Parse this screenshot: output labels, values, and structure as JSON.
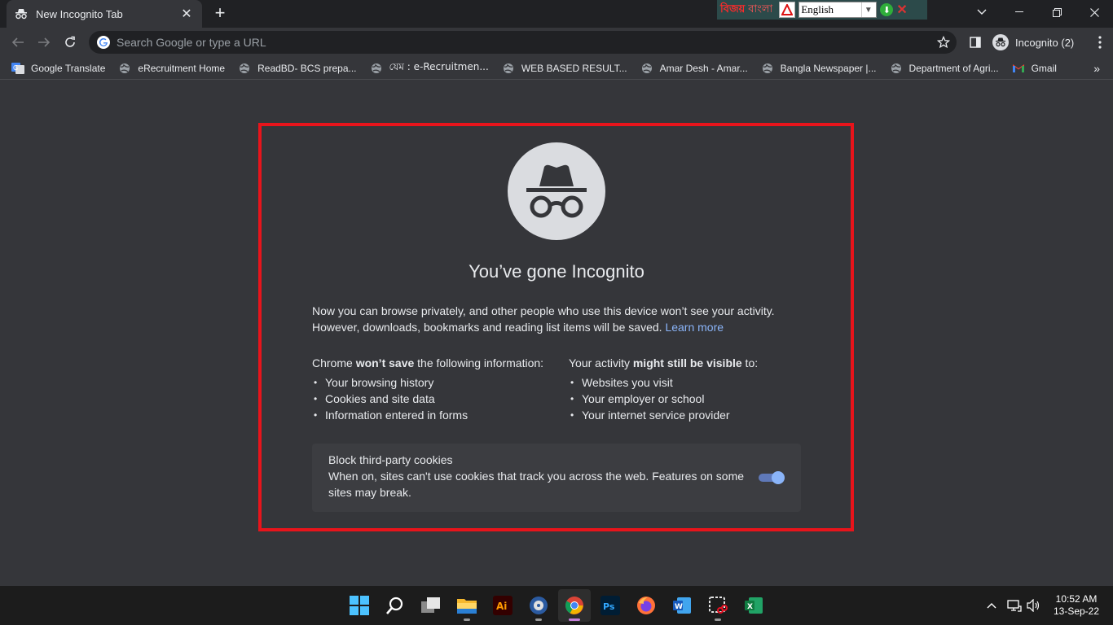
{
  "tab": {
    "title": "New Incognito Tab",
    "close": "✕"
  },
  "ime_toolbar": {
    "brand": "বিজয়",
    "script": "বাংলা",
    "language": "English"
  },
  "omnibox": {
    "placeholder": "Search Google or type a URL"
  },
  "profile": {
    "label": "Incognito (2)"
  },
  "bookmarks": [
    {
      "label": "Google Translate",
      "icon": "google-translate-icon"
    },
    {
      "label": "eRecruitment Home",
      "icon": "globe-icon"
    },
    {
      "label": "ReadBD- BCS prepa...",
      "icon": "globe-icon"
    },
    {
      "label": "যেম : e-Recruitmen...",
      "icon": "globe-icon"
    },
    {
      "label": "WEB BASED RESULT...",
      "icon": "globe-icon"
    },
    {
      "label": "Amar Desh - Amar...",
      "icon": "globe-icon"
    },
    {
      "label": "Bangla Newspaper |...",
      "icon": "globe-icon"
    },
    {
      "label": "Department of Agri...",
      "icon": "globe-icon"
    },
    {
      "label": "Gmail",
      "icon": "gmail-icon"
    }
  ],
  "incognito": {
    "headline": "You’ve gone Incognito",
    "intro_line1": "Now you can browse privately, and other people who use this device won’t see your activity.",
    "intro_line2": "However, downloads, bookmarks and reading list items will be saved.",
    "learn_more": "Learn more",
    "left_head_pre": "Chrome ",
    "left_head_bold": "won’t save",
    "left_head_post": " the following information:",
    "left_items": [
      "Your browsing history",
      "Cookies and site data",
      "Information entered in forms"
    ],
    "right_head_pre": "Your activity ",
    "right_head_bold": "might still be visible",
    "right_head_post": " to:",
    "right_items": [
      "Websites you visit",
      "Your employer or school",
      "Your internet service provider"
    ],
    "cookie_title": "Block third-party cookies",
    "cookie_desc": "When on, sites can't use cookies that track you across the web. Features on some sites may break.",
    "cookie_toggle_on": true
  },
  "taskbar": {
    "apps": [
      "start",
      "search",
      "task-view",
      "file-explorer",
      "illustrator",
      "media-player",
      "chrome",
      "photoshop",
      "firefox",
      "word",
      "snipping-tool",
      "excel"
    ],
    "time": "10:52 AM",
    "date": "13-Sep-22"
  },
  "colors": {
    "accent": "#8ab4f8",
    "highlight_border": "#e8141b",
    "background": "#35363a"
  }
}
